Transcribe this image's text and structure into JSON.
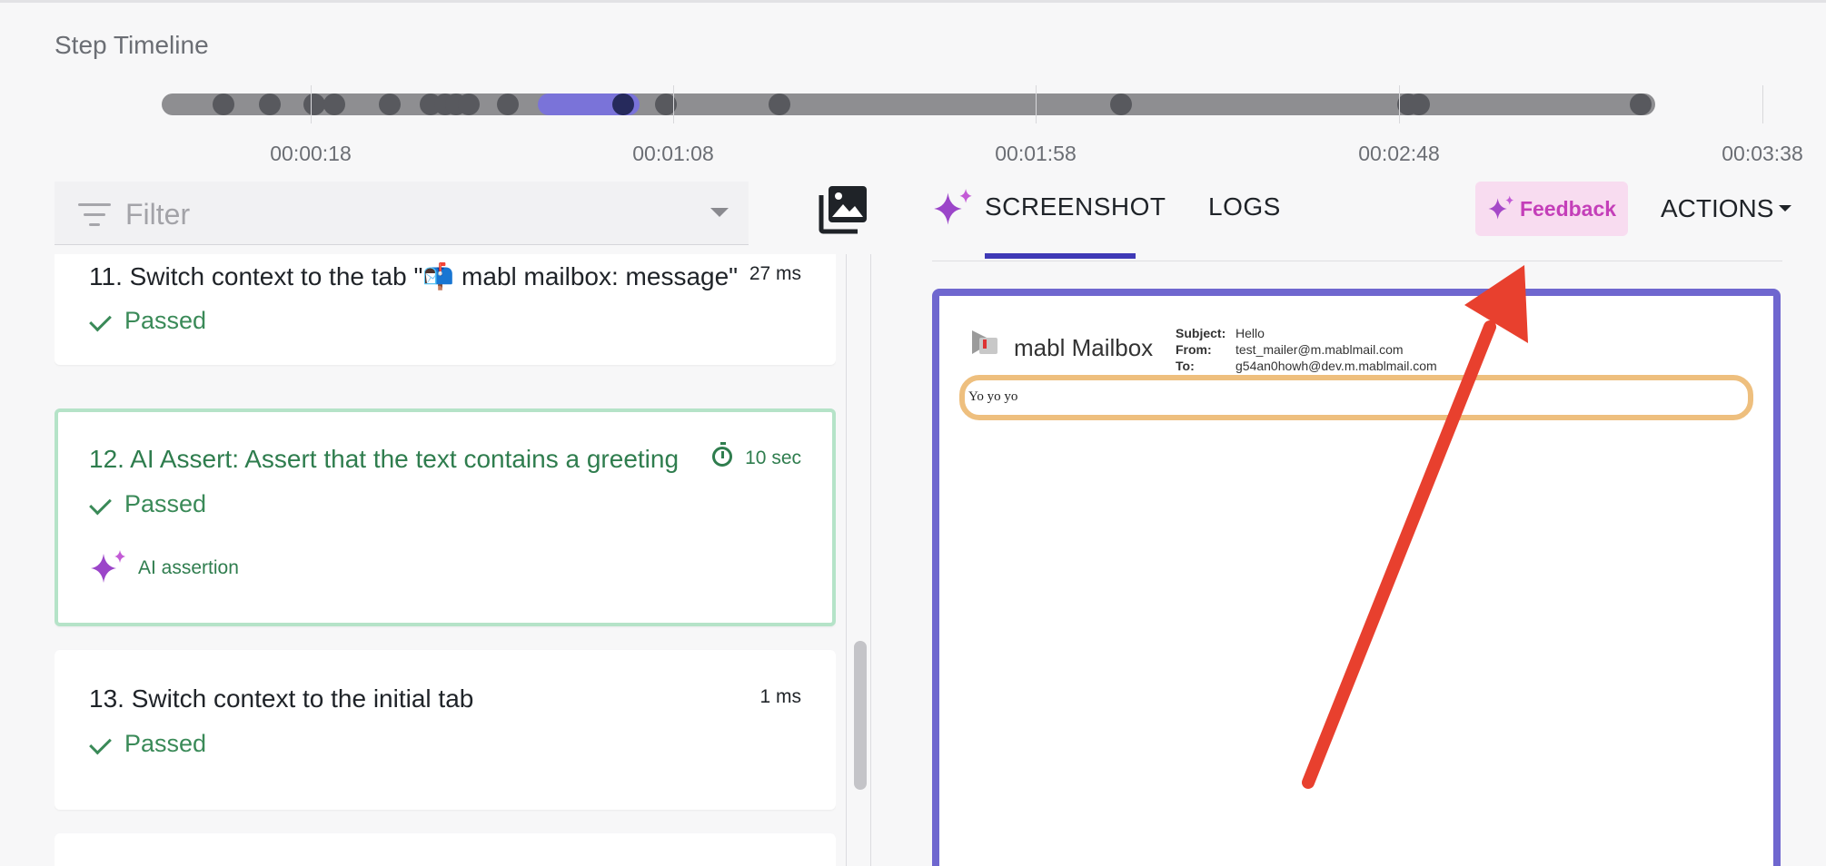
{
  "section_title": "Step Timeline",
  "timeline": {
    "tick_labels": [
      "00:00:18",
      "00:01:08",
      "00:01:58",
      "00:02:48",
      "00:03:38"
    ]
  },
  "filter": {
    "placeholder": "Filter"
  },
  "steps": [
    {
      "title": "11. Switch context to the tab \"📬 mabl mailbox: message\"",
      "time": "27 ms",
      "status": "Passed"
    },
    {
      "title": "12. AI Assert: Assert that the text contains a greeting",
      "time": "10 sec",
      "status": "Passed",
      "tag": "AI assertion",
      "selected": true
    },
    {
      "title": "13. Switch context to the initial tab",
      "time": "1 ms",
      "status": "Passed"
    }
  ],
  "tabs": {
    "screenshot": "SCREENSHOT",
    "logs": "LOGS",
    "feedback": "Feedback",
    "actions": "ACTIONS"
  },
  "preview": {
    "app_title": "mabl Mailbox",
    "subject_label": "Subject:",
    "subject": "Hello",
    "from_label": "From:",
    "from": "test_mailer@m.mablmail.com",
    "to_label": "To:",
    "to": "g54an0howh@dev.m.mablmail.com",
    "body": "Yo yo yo"
  },
  "colors": {
    "accent": "#3f39b6",
    "highlight": "#7a73d9",
    "passed": "#3a8a58",
    "feedback": "#c43fb9",
    "annotation_arrow": "#e8402e"
  }
}
